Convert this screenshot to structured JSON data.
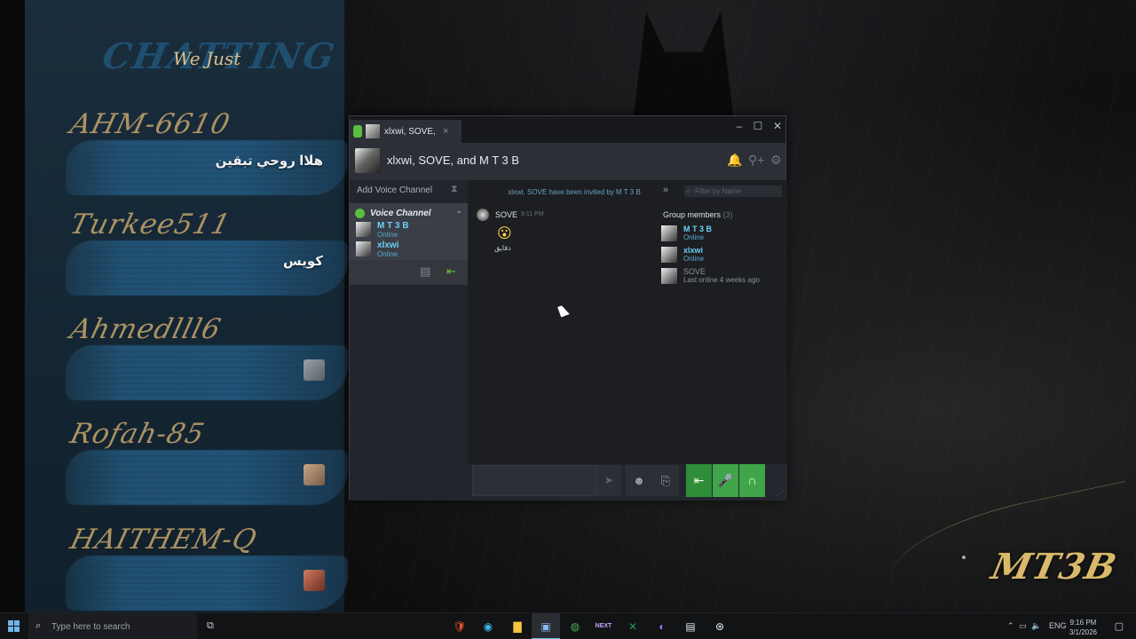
{
  "overlay": {
    "title": "CHATTING",
    "subtitle": "We Just",
    "entries": [
      {
        "user": "AHM-6610",
        "message": "هلاا روحي تبقين"
      },
      {
        "user": "Turkee511",
        "message": "كويس"
      },
      {
        "user": "Ahmedlll6",
        "message": ""
      },
      {
        "user": "Rofah-85",
        "message": ""
      },
      {
        "user": "HAITHEM-Q",
        "message": ""
      }
    ]
  },
  "brand": {
    "logo_text": "MT3B",
    "accent": "#d9b96a"
  },
  "steam": {
    "tab_label": "xlxwi, SOVE, a",
    "tab_close": "×",
    "window_controls": {
      "minimize": "–",
      "maximize": "☐",
      "close": "✕"
    },
    "group_name": "xlxwi, SOVE, and M T 3 B",
    "header_icons": [
      "bell-icon",
      "add-user-icon",
      "settings-icon"
    ],
    "add_voice_channel": "Add Voice Channel",
    "voice_channel": {
      "label": "Voice Channel",
      "members": [
        {
          "name": "M T 3 B",
          "status": "Online"
        },
        {
          "name": "xlxwi",
          "status": "Online"
        }
      ]
    },
    "invite_note": "xlxwi, SOVE have been invited by M T 3 B",
    "message": {
      "sender": "SOVE",
      "time": "9:11 PM",
      "emoji": "😮",
      "text": "دقايق"
    },
    "filter_placeholder": "Filter by Name",
    "group_members_title": "Group members",
    "group_members_count": "(3)",
    "group_members": [
      {
        "name": "M T 3 B",
        "status": "Online"
      },
      {
        "name": "xlxwi",
        "status": "Online"
      },
      {
        "name": "SOVE",
        "status": "Last online 4 weeks ago"
      }
    ],
    "accent_green": "#59bf40",
    "online_blue": "#6dcff6"
  },
  "taskbar": {
    "search_placeholder": "Type here to search",
    "apps": [
      "brave-icon",
      "edge-icon",
      "file-explorer-icon",
      "active-window-icon",
      "chrome-icon",
      "next-app-icon",
      "excel-icon",
      "messenger-icon",
      "notepad-icon",
      "steam-icon"
    ],
    "next_label": "NEXT",
    "language": "ENG",
    "time": "9:16 PM",
    "date": "3/1/2026"
  }
}
